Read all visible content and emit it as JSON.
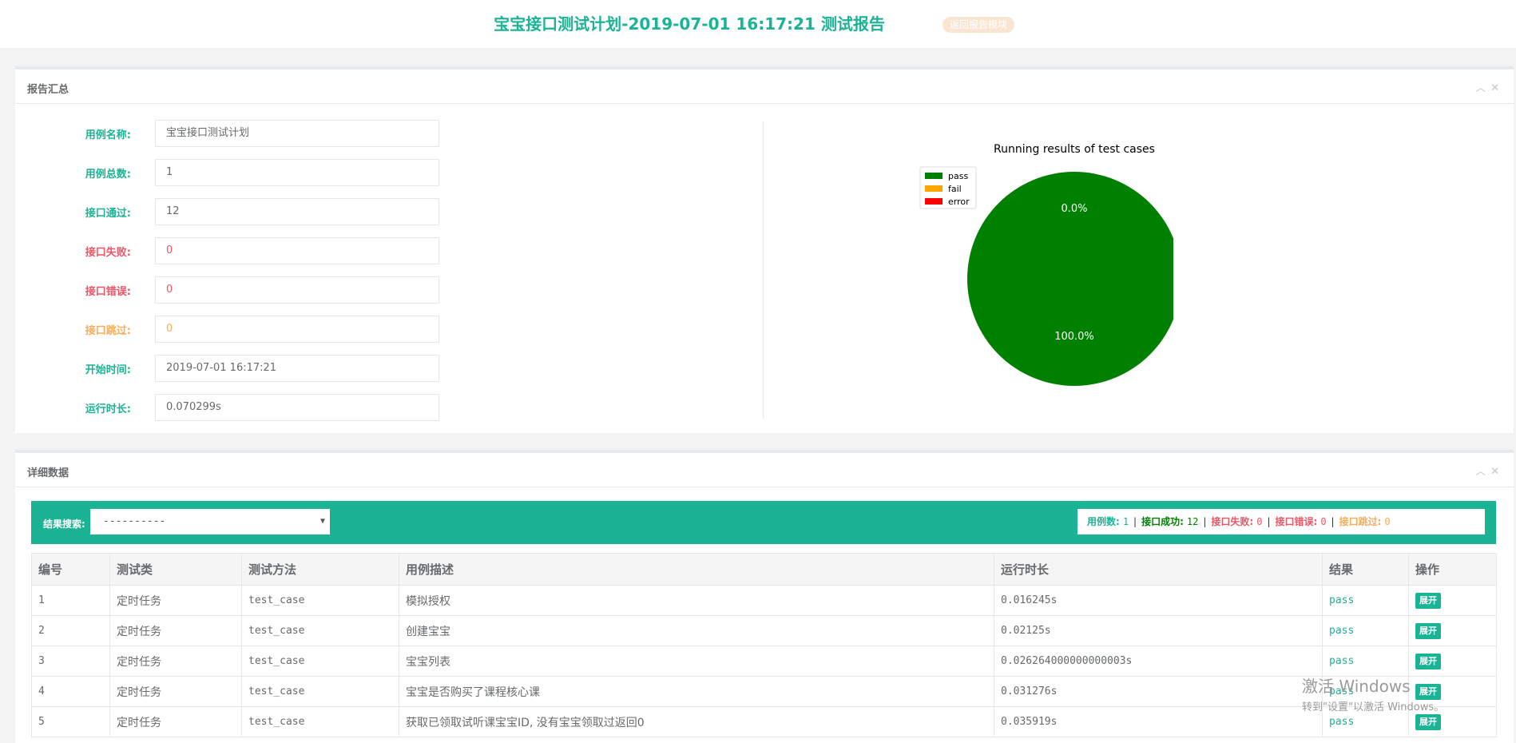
{
  "header": {
    "title": "宝宝接口测试计划-2019-07-01 16:17:21 测试报告",
    "back_label": "返回报告模块"
  },
  "summary": {
    "title": "报告汇总",
    "rows": [
      {
        "label": "用例名称:",
        "value": "宝宝接口测试计划",
        "color": "#1ab394",
        "value_color": "#676a6c"
      },
      {
        "label": "用例总数:",
        "value": "1",
        "color": "#1ab394",
        "value_color": "#676a6c"
      },
      {
        "label": "接口通过:",
        "value": "12",
        "color": "#1ab394",
        "value_color": "#676a6c"
      },
      {
        "label": "接口失败:",
        "value": "0",
        "color": "#ed5565",
        "value_color": "#ed5565"
      },
      {
        "label": "接口错误:",
        "value": "0",
        "color": "#ed5565",
        "value_color": "#ed5565"
      },
      {
        "label": "接口跳过:",
        "value": "0",
        "color": "#f8ac59",
        "value_color": "#f8ac59"
      },
      {
        "label": "开始时间:",
        "value": "2019-07-01 16:17:21",
        "color": "#1ab394",
        "value_color": "#676a6c"
      },
      {
        "label": "运行时长:",
        "value": "0.070299s",
        "color": "#1ab394",
        "value_color": "#676a6c"
      }
    ]
  },
  "chart_data": {
    "type": "pie",
    "title": "Running results of test cases",
    "categories": [
      "pass",
      "fail",
      "error"
    ],
    "values": [
      100.0,
      0.0,
      0.0
    ],
    "labels": [
      "100.0%",
      "0.0%",
      ""
    ],
    "colors": [
      "#008000",
      "#ffa500",
      "#ff0000"
    ],
    "legend_position": "top-left"
  },
  "details": {
    "title": "详细数据",
    "search_label": "结果搜索:",
    "select_value": "----------",
    "stats": [
      {
        "label": "用例数:",
        "value": "1",
        "color": "#1ab394"
      },
      {
        "label": "接口成功:",
        "value": "12",
        "color": "#008000"
      },
      {
        "label": "接口失败:",
        "value": "0",
        "color": "#ed5565"
      },
      {
        "label": "接口错误:",
        "value": "0",
        "color": "#ed5565"
      },
      {
        "label": "接口跳过:",
        "value": "0",
        "color": "#f8ac59"
      }
    ],
    "columns": [
      "编号",
      "测试类",
      "测试方法",
      "用例描述",
      "运行时长",
      "结果",
      "操作"
    ],
    "rows": [
      {
        "id": "1",
        "cls": "定时任务",
        "method": "test_case",
        "desc": "模拟授权",
        "duration": "0.016245s",
        "result": "pass",
        "action": "展开"
      },
      {
        "id": "2",
        "cls": "定时任务",
        "method": "test_case",
        "desc": "创建宝宝",
        "duration": "0.02125s",
        "result": "pass",
        "action": "展开"
      },
      {
        "id": "3",
        "cls": "定时任务",
        "method": "test_case",
        "desc": "宝宝列表",
        "duration": "0.026264000000000003s",
        "result": "pass",
        "action": "展开"
      },
      {
        "id": "4",
        "cls": "定时任务",
        "method": "test_case",
        "desc": "宝宝是否购买了课程核心课",
        "duration": "0.031276s",
        "result": "pass",
        "action": "展开"
      },
      {
        "id": "5",
        "cls": "定时任务",
        "method": "test_case",
        "desc": "获取已领取试听课宝宝ID, 没有宝宝领取过返回0",
        "duration": "0.035919s",
        "result": "pass",
        "action": "展开"
      }
    ]
  },
  "watermark": {
    "line1": "激活 Windows",
    "line2": "转到\"设置\"以激活 Windows。"
  }
}
